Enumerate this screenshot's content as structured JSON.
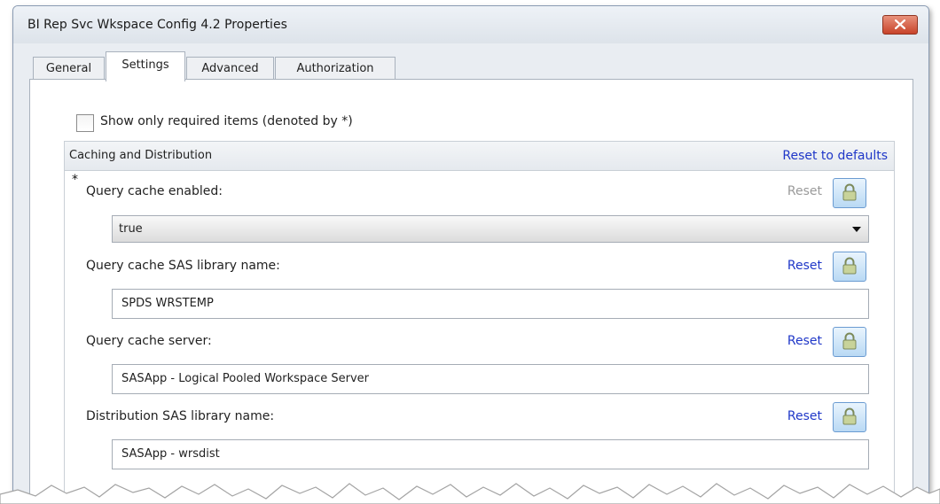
{
  "window": {
    "title": "BI Rep Svc Wkspace Config 4.2 Properties"
  },
  "tabs": [
    {
      "label": "General",
      "active": false
    },
    {
      "label": "Settings",
      "active": true
    },
    {
      "label": "Advanced",
      "active": false
    },
    {
      "label": "Authorization",
      "active": false
    }
  ],
  "settings": {
    "show_required": {
      "label": "Show only required items (denoted by *)",
      "checked": false
    },
    "group": {
      "title": "Caching and Distribution",
      "reset_defaults": "Reset to defaults",
      "fields": [
        {
          "label": "Query cache enabled:",
          "required": true,
          "required_marker": "*",
          "type": "select",
          "value": "true",
          "reset": "Reset",
          "reset_enabled": false
        },
        {
          "label": "Query cache SAS library name:",
          "required": false,
          "type": "text",
          "value": "SPDS WRSTEMP",
          "reset": "Reset",
          "reset_enabled": true
        },
        {
          "label": "Query cache server:",
          "required": false,
          "type": "text",
          "value": "SASApp - Logical Pooled Workspace Server",
          "reset": "Reset",
          "reset_enabled": true
        },
        {
          "label": "Distribution SAS library name:",
          "required": false,
          "type": "text",
          "value": "SASApp - wrsdist",
          "reset": "Reset",
          "reset_enabled": true
        }
      ]
    }
  },
  "icons": {
    "close": "close-icon",
    "lock": "lock-icon",
    "dropdown": "chevron-down-icon"
  },
  "colors": {
    "link": "#1f37c8",
    "close_button": "#c8432a",
    "lock_border": "#6a9bd1"
  }
}
